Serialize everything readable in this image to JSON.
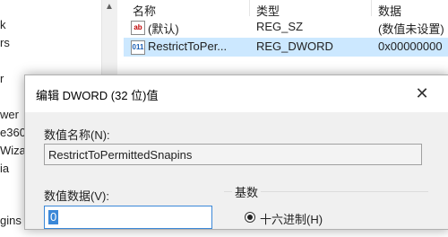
{
  "tree": {
    "items": [
      "k",
      "rs",
      "r",
      "wer",
      "e360",
      "Wizard",
      "ia",
      "gins"
    ]
  },
  "list": {
    "columns": [
      "名称",
      "类型",
      "数据"
    ],
    "rows": [
      {
        "icon": "ab",
        "name": "(默认)",
        "type": "REG_SZ",
        "data": "(数值未设置)",
        "selected": false
      },
      {
        "icon": "011",
        "name": "RestrictToPer...",
        "type": "REG_DWORD",
        "data": "0x00000000",
        "selected": true
      }
    ]
  },
  "dialog": {
    "title": "编辑 DWORD (32 位)值",
    "close": "✕",
    "name_label": "数值名称(N):",
    "name_value": "RestrictToPermittedSnapins",
    "data_label": "数值数据(V):",
    "data_value": "0",
    "base_label": "基数",
    "hex_label": "十六进制(H)"
  }
}
